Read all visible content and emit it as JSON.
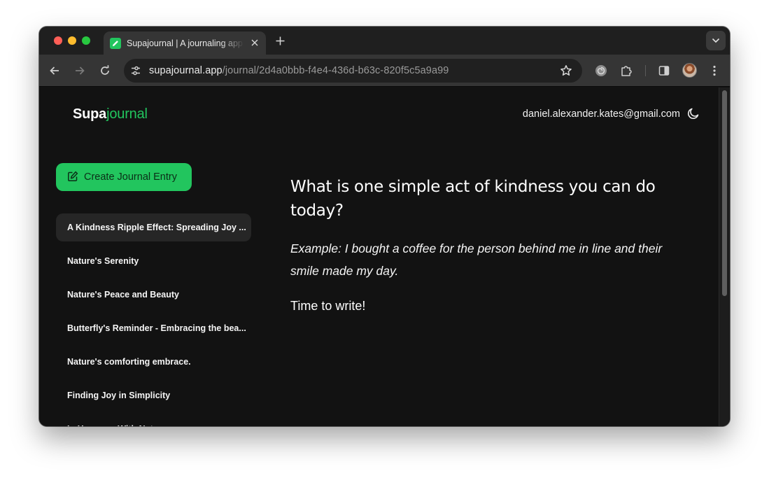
{
  "browser": {
    "tab_title": "Supajournal | A journaling app",
    "url_host": "supajournal.app",
    "url_path": "/journal/2d4a0bbb-f4e4-436d-b63c-820f5c5a9a99"
  },
  "header": {
    "brand_primary": "Supa",
    "brand_accent": "journal",
    "user_email": "daniel.alexander.kates@gmail.com"
  },
  "sidebar": {
    "create_label": "Create Journal Entry",
    "entries": [
      "A Kindness Ripple Effect: Spreading Joy ...",
      "Nature's Serenity",
      "Nature's Peace and Beauty",
      "Butterfly's Reminder - Embracing the bea...",
      "Nature's comforting embrace.",
      "Finding Joy in Simplicity",
      "In Harmony With Nature"
    ]
  },
  "main": {
    "prompt": "What is one simple act of kindness you can do today?",
    "example": "Example: I bought a coffee for the person behind me in line and their smile made my day.",
    "placeholder": "Time to write!"
  },
  "colors": {
    "accent": "#22c55e",
    "background": "#121212",
    "active_item": "#262626"
  }
}
